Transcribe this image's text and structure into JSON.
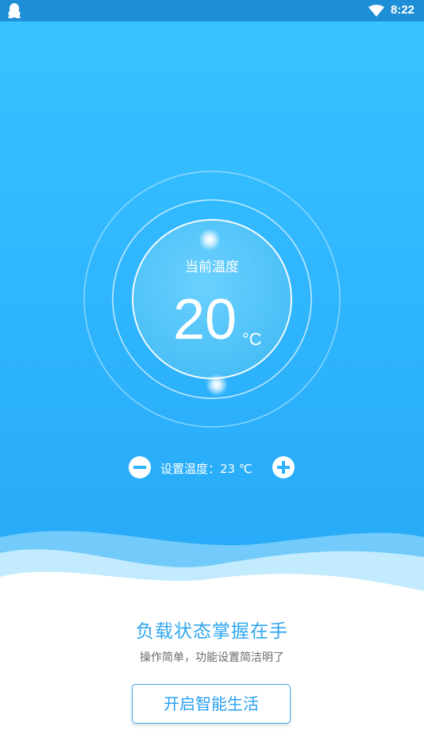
{
  "status_bar": {
    "time": "8:22",
    "icons": [
      "qq-penguin-icon",
      "wifi-icon"
    ]
  },
  "thermostat": {
    "current_label": "当前温度",
    "current_value": "20",
    "current_unit": "°C",
    "set_text": "设置温度：23 ℃",
    "set_value": 23
  },
  "promo": {
    "headline": "负载状态掌握在手",
    "subline": "操作简单，功能设置简洁明了",
    "button_label": "开启智能生活"
  },
  "colors": {
    "sky_top": "#38c3ff",
    "sky_bottom": "#27a9f6",
    "accent": "#2fa6ee",
    "status_bar": "#1e8fd6"
  }
}
